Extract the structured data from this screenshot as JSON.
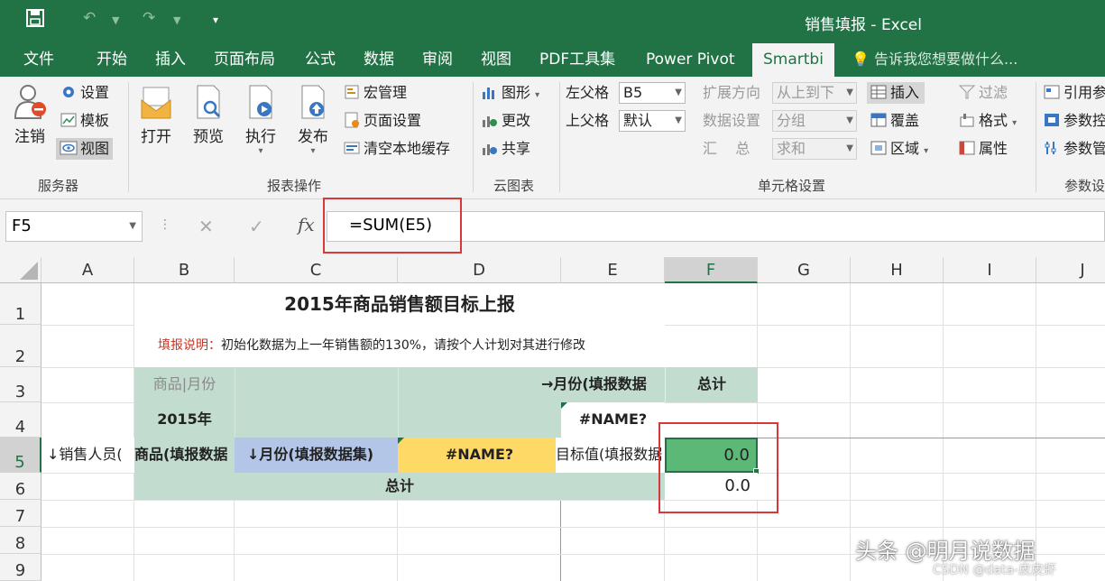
{
  "window": {
    "title": "销售填报 - Excel"
  },
  "tabs": [
    "文件",
    "开始",
    "插入",
    "页面布局",
    "公式",
    "数据",
    "审阅",
    "视图",
    "PDF工具集",
    "Power Pivot",
    "Smartbi"
  ],
  "tell_me": "告诉我您想要做什么...",
  "ribbon": {
    "server": {
      "label": "服务器",
      "logout": "注销",
      "settings": "设置",
      "template": "模板",
      "view": "视图"
    },
    "report": {
      "label": "报表操作",
      "open": "打开",
      "preview": "预览",
      "execute": "执行",
      "publish": "发布",
      "macro": "宏管理",
      "page_setup": "页面设置",
      "clear_cache": "清空本地缓存"
    },
    "cloud": {
      "label": "云图表",
      "chart": "图形",
      "change": "更改",
      "share": "共享"
    },
    "cell": {
      "label": "单元格设置",
      "left_parent": "左父格",
      "left_parent_value": "B5",
      "top_parent": "上父格",
      "top_parent_value": "默认",
      "expand_dir": "扩展方向",
      "expand_dir_value": "从上到下",
      "data_setting": "数据设置",
      "data_setting_value": "分组",
      "summary": "汇    总",
      "summary_value": "求和",
      "insert": "插入",
      "cover": "覆盖",
      "region": "区域",
      "filter": "过滤",
      "format": "格式",
      "property": "属性"
    },
    "param": {
      "label": "参数设",
      "ref": "引用参",
      "p2": "参数控",
      "p3": "参数管"
    }
  },
  "formula_bar": {
    "name_box": "F5",
    "formula": "=SUM(E5)",
    "fx": "fx"
  },
  "columns": [
    "A",
    "B",
    "C",
    "D",
    "E",
    "F",
    "G",
    "H",
    "I",
    "J"
  ],
  "rows": [
    "1",
    "2",
    "3",
    "4",
    "5",
    "6",
    "7",
    "8",
    "9"
  ],
  "sheet": {
    "title": "2015年商品销售额目标上报",
    "note_label": "填报说明：",
    "note_text": "初始化数据为上一年销售额的130%，请按个人计划对其进行修改",
    "b3": "商品|月份",
    "e3": "→月份(填报数据",
    "f3": "总计",
    "b4": "2015年",
    "e4": "#NAME?",
    "a5": "↓销售人员(",
    "b5": "商品(填报数据",
    "c5": "↓月份(填报数据集)",
    "d5": "#NAME?",
    "e5": "目标值(填报数据",
    "f5": "0.0",
    "b6": "总计",
    "f6": "0.0"
  },
  "watermark": {
    "main": "头条 @明月说数据",
    "sub": "CSDN @data-皮皮虾"
  },
  "colors": {
    "excel_green": "#217346",
    "cell_green": "#c2dccf",
    "blue": "#b4c6e7",
    "yellow": "#ffd966",
    "selected": "#5bb877",
    "highlight": "#d8383a"
  }
}
